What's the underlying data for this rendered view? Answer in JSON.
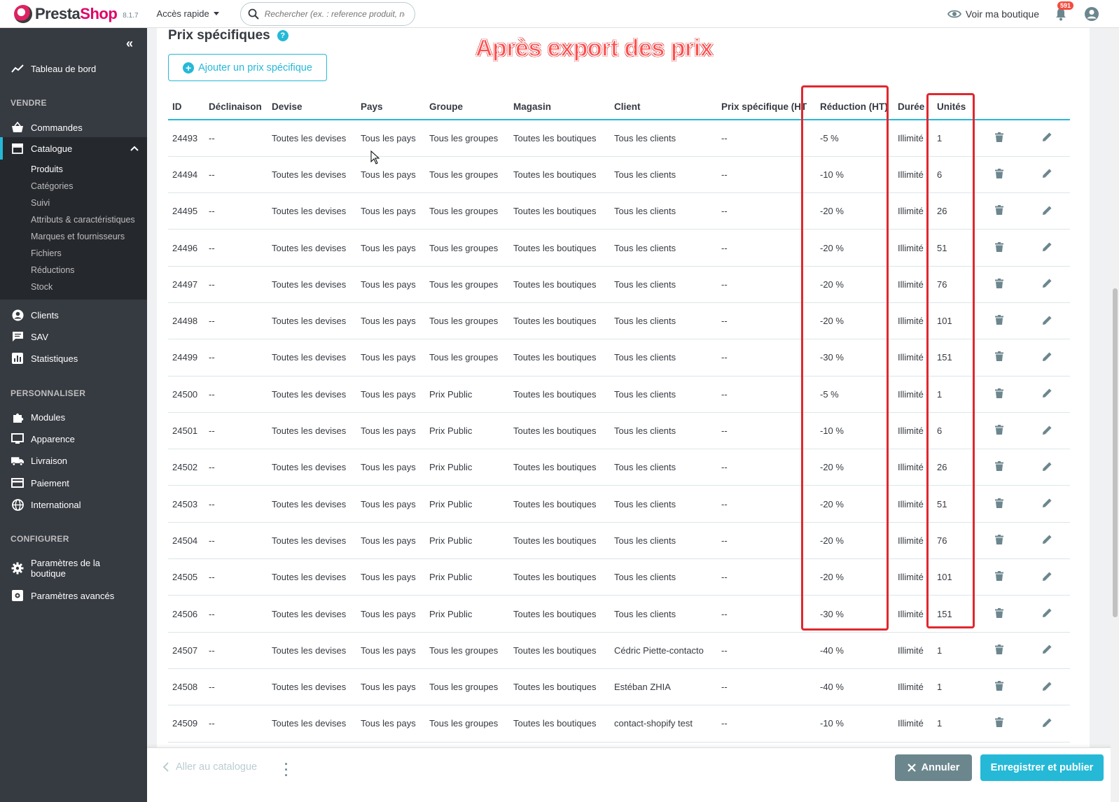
{
  "header": {
    "logo_presta": "Presta",
    "logo_shop": "Shop",
    "version": "8.1.7",
    "quick_access": "Accès rapide",
    "search_placeholder": "Rechercher (ex. : reference produit, no",
    "view_shop": "Voir ma boutique",
    "notifications_count": "591"
  },
  "sidebar": {
    "dashboard": "Tableau de bord",
    "section_sell": "VENDRE",
    "orders": "Commandes",
    "catalogue": "Catalogue",
    "catalogue_sub": [
      "Produits",
      "Catégories",
      "Suivi",
      "Attributs & caractéristiques",
      "Marques et fournisseurs",
      "Fichiers",
      "Réductions",
      "Stock"
    ],
    "customers": "Clients",
    "sav": "SAV",
    "stats": "Statistiques",
    "section_customize": "PERSONNALISER",
    "modules": "Modules",
    "appearance": "Apparence",
    "shipping": "Livraison",
    "payment": "Paiement",
    "international": "International",
    "section_configure": "CONFIGURER",
    "shop_params": "Paramètres de la boutique",
    "advanced_params": "Paramètres avancés"
  },
  "main": {
    "title": "Prix spécifiques",
    "add_button": "Ajouter un prix spécifique",
    "annotation": "Après export des prix",
    "columns": [
      "ID",
      "Déclinaison",
      "Devise",
      "Pays",
      "Groupe",
      "Magasin",
      "Client",
      "Prix spécifique (HT",
      "Réduction (HT)",
      "Durée",
      "Unités"
    ],
    "rows": [
      [
        "24493",
        "--",
        "Toutes les devises",
        "Tous les pays",
        "Tous les groupes",
        "Toutes les boutiques",
        "Tous les clients",
        "--",
        "-5 %",
        "Illimité",
        "1"
      ],
      [
        "24494",
        "--",
        "Toutes les devises",
        "Tous les pays",
        "Tous les groupes",
        "Toutes les boutiques",
        "Tous les clients",
        "--",
        "-10 %",
        "Illimité",
        "6"
      ],
      [
        "24495",
        "--",
        "Toutes les devises",
        "Tous les pays",
        "Tous les groupes",
        "Toutes les boutiques",
        "Tous les clients",
        "--",
        "-20 %",
        "Illimité",
        "26"
      ],
      [
        "24496",
        "--",
        "Toutes les devises",
        "Tous les pays",
        "Tous les groupes",
        "Toutes les boutiques",
        "Tous les clients",
        "--",
        "-20 %",
        "Illimité",
        "51"
      ],
      [
        "24497",
        "--",
        "Toutes les devises",
        "Tous les pays",
        "Tous les groupes",
        "Toutes les boutiques",
        "Tous les clients",
        "--",
        "-20 %",
        "Illimité",
        "76"
      ],
      [
        "24498",
        "--",
        "Toutes les devises",
        "Tous les pays",
        "Tous les groupes",
        "Toutes les boutiques",
        "Tous les clients",
        "--",
        "-20 %",
        "Illimité",
        "101"
      ],
      [
        "24499",
        "--",
        "Toutes les devises",
        "Tous les pays",
        "Tous les groupes",
        "Toutes les boutiques",
        "Tous les clients",
        "--",
        "-30 %",
        "Illimité",
        "151"
      ],
      [
        "24500",
        "--",
        "Toutes les devises",
        "Tous les pays",
        "Prix Public",
        "Toutes les boutiques",
        "Tous les clients",
        "--",
        "-5 %",
        "Illimité",
        "1"
      ],
      [
        "24501",
        "--",
        "Toutes les devises",
        "Tous les pays",
        "Prix Public",
        "Toutes les boutiques",
        "Tous les clients",
        "--",
        "-10 %",
        "Illimité",
        "6"
      ],
      [
        "24502",
        "--",
        "Toutes les devises",
        "Tous les pays",
        "Prix Public",
        "Toutes les boutiques",
        "Tous les clients",
        "--",
        "-20 %",
        "Illimité",
        "26"
      ],
      [
        "24503",
        "--",
        "Toutes les devises",
        "Tous les pays",
        "Prix Public",
        "Toutes les boutiques",
        "Tous les clients",
        "--",
        "-20 %",
        "Illimité",
        "51"
      ],
      [
        "24504",
        "--",
        "Toutes les devises",
        "Tous les pays",
        "Prix Public",
        "Toutes les boutiques",
        "Tous les clients",
        "--",
        "-20 %",
        "Illimité",
        "76"
      ],
      [
        "24505",
        "--",
        "Toutes les devises",
        "Tous les pays",
        "Prix Public",
        "Toutes les boutiques",
        "Tous les clients",
        "--",
        "-20 %",
        "Illimité",
        "101"
      ],
      [
        "24506",
        "--",
        "Toutes les devises",
        "Tous les pays",
        "Prix Public",
        "Toutes les boutiques",
        "Tous les clients",
        "--",
        "-30 %",
        "Illimité",
        "151"
      ],
      [
        "24507",
        "--",
        "Toutes les devises",
        "Tous les pays",
        "Tous les groupes",
        "Toutes les boutiques",
        "Cédric Piette-contacto",
        "--",
        "-40 %",
        "Illimité",
        "1"
      ],
      [
        "24508",
        "--",
        "Toutes les devises",
        "Tous les pays",
        "Tous les groupes",
        "Toutes les boutiques",
        "Estéban ZHIA",
        "--",
        "-40 %",
        "Illimité",
        "1"
      ],
      [
        "24509",
        "--",
        "Toutes les devises",
        "Tous les pays",
        "Tous les groupes",
        "Toutes les boutiques",
        "contact-shopify test",
        "--",
        "-10 %",
        "Illimité",
        "1"
      ]
    ]
  },
  "footer": {
    "back_link": "Aller au catalogue",
    "cancel": "Annuler",
    "save": "Enregistrer et publier"
  },
  "colors": {
    "accent": "#25b9d7",
    "sidebar_bg": "#363a41",
    "highlight_box": "#e0282e",
    "brand": "#df0067"
  }
}
